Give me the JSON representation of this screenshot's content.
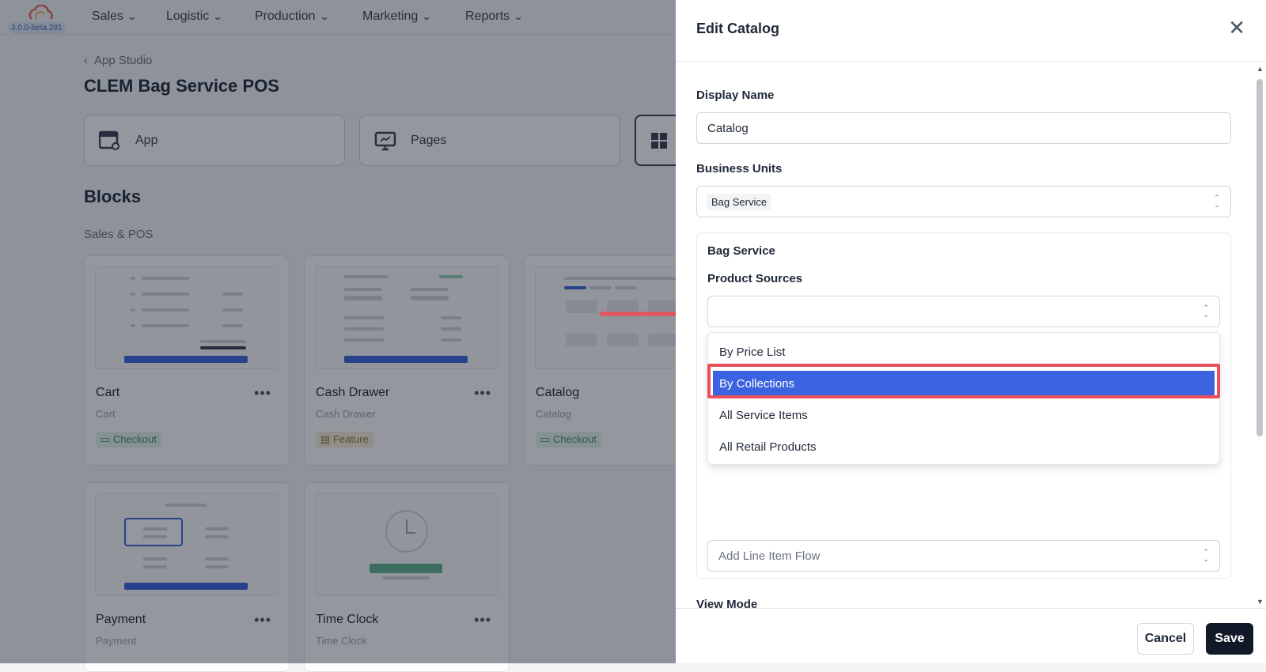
{
  "app": {
    "version": "3.0.0-beta.281"
  },
  "nav": {
    "items": [
      {
        "label": "Sales"
      },
      {
        "label": "Logistic"
      },
      {
        "label": "Production"
      },
      {
        "label": "Marketing"
      },
      {
        "label": "Reports"
      }
    ]
  },
  "breadcrumb": {
    "back_label": "App Studio"
  },
  "page": {
    "title": "CLEM Bag Service POS"
  },
  "top_cards": [
    {
      "label": "App",
      "icon": "app-settings-icon"
    },
    {
      "label": "Pages",
      "icon": "monitor-icon"
    },
    {
      "label": "",
      "icon": "grid-icon"
    }
  ],
  "blocks_section": {
    "title": "Blocks",
    "subtitle": "Sales & POS"
  },
  "blocks": [
    {
      "name": "Cart",
      "sub": "Cart",
      "tag": "Checkout",
      "tag_color": "green"
    },
    {
      "name": "Cash Drawer",
      "sub": "Cash Drawer",
      "tag": "Feature",
      "tag_color": "yellow"
    },
    {
      "name": "Catalog",
      "sub": "Catalog",
      "tag": "Checkout",
      "tag_color": "green"
    },
    {
      "name": "Payment",
      "sub": "Payment"
    },
    {
      "name": "Time Clock",
      "sub": "Time Clock"
    }
  ],
  "more_label": "•••",
  "panel": {
    "title": "Edit Catalog",
    "display_name_label": "Display Name",
    "display_name_value": "Catalog",
    "business_units_label": "Business Units",
    "business_units_chip": "Bag Service",
    "group_title": "Bag Service",
    "product_sources_label": "Product Sources",
    "product_sources_value": "",
    "options": [
      "By Price List",
      "By Collections",
      "All Service Items",
      "All Retail Products"
    ],
    "selected_option": "By Collections",
    "add_line_item_placeholder": "Add Line Item Flow",
    "view_mode_label": "View Mode",
    "cancel_label": "Cancel",
    "save_label": "Save"
  },
  "colors": {
    "highlight": "#e8505b",
    "selected": "#3b63e0",
    "primary_button": "#111827"
  }
}
